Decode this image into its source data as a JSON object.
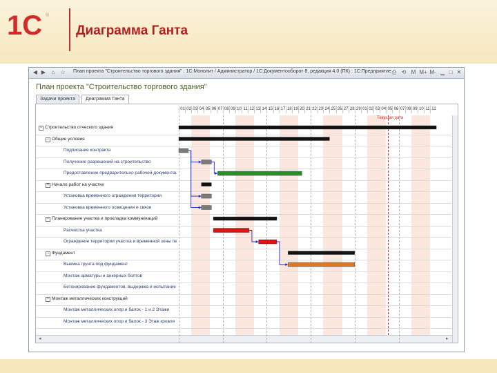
{
  "slide": {
    "title": "Диаграмма Ганта",
    "logo_text": "1С",
    "accent_color": "#c62828",
    "header_bg": "#f6e7bd"
  },
  "window": {
    "title": "План проекта \"Строительство торгового здания\" : 1С:Монолит / Администратор / 1С:Документооборот 8, редакция 4.0 (ПК) : 1С:Предприятие",
    "toolbar_icons": [
      "back-icon",
      "forward-icon",
      "home-icon",
      "favorite-icon"
    ],
    "window_icons": [
      "print-icon",
      "history-icon",
      "M",
      "M+",
      "M-",
      "minimize-icon",
      "maximize-icon",
      "close-icon"
    ]
  },
  "form": {
    "title": "План проекта \"Строительство торгового здания\"",
    "tabs": [
      {
        "label": "Задачи проекта",
        "active": false
      },
      {
        "label": "Диаграмма Ганта",
        "active": true
      }
    ]
  },
  "gantt": {
    "today_label": "Текущая дата",
    "columns": [
      "01",
      "02",
      "03",
      "04",
      "05",
      "06",
      "07",
      "08",
      "09",
      "10",
      "11",
      "12",
      "13",
      "14",
      "15",
      "16",
      "17",
      "18",
      "19",
      "20",
      "21",
      "22",
      "23",
      "24",
      "25",
      "26",
      "27",
      "28",
      "29",
      "01",
      "02",
      "03",
      "04",
      "05",
      "06",
      "07",
      "08",
      "09",
      "10",
      "11",
      "12"
    ],
    "weekend_columns": [
      2,
      3,
      9,
      10,
      16,
      17,
      23,
      24,
      30,
      31,
      37,
      38
    ],
    "today_column": 33.3,
    "colors": {
      "summary": "#111111",
      "normal": "#7a7a7a",
      "green": "#2e8b2e",
      "red": "#e31010",
      "orange": "#d97a2b",
      "link": "#1f2fc7"
    },
    "tasks": [
      {
        "label": "Строительство отческого здания",
        "level": 0,
        "expander": "−",
        "start": 0,
        "end": 41,
        "kind": "summary"
      },
      {
        "label": "Общие условия",
        "level": 1,
        "expander": "−",
        "start": 0,
        "end": 24,
        "kind": "summary"
      },
      {
        "label": "Подписание контракта",
        "level": 2,
        "expander": "",
        "start": 0,
        "end": 1.5,
        "kind": "normal"
      },
      {
        "label": "Получение разрешений на строительство",
        "level": 2,
        "expander": "",
        "start": 3.6,
        "end": 5.2,
        "kind": "normal"
      },
      {
        "label": "Предоставление предварительно рабочей документации",
        "level": 2,
        "expander": "",
        "start": 6.2,
        "end": 19.6,
        "kind": "green"
      },
      {
        "label": "Начало работ на участке",
        "level": 1,
        "expander": "+",
        "start": 3.6,
        "end": 5.2,
        "kind": "summary"
      },
      {
        "label": "Установка временного ограждения территории",
        "level": 2,
        "expander": "",
        "start": 3.6,
        "end": 5.2,
        "kind": "normal"
      },
      {
        "label": "Установка временного освещения и связи",
        "level": 2,
        "expander": "",
        "start": 3.6,
        "end": 5.2,
        "kind": "normal"
      },
      {
        "label": "Планирование участка и прокладка коммуникаций",
        "level": 1,
        "expander": "−",
        "start": 5.5,
        "end": 15.6,
        "kind": "summary"
      },
      {
        "label": "Расчистка участка",
        "level": 2,
        "expander": "",
        "start": 5.5,
        "end": 11.2,
        "kind": "red"
      },
      {
        "label": "Ограждение территории участка и временной зоны персонала",
        "level": 2,
        "expander": "",
        "start": 12.7,
        "end": 15.6,
        "kind": "red"
      },
      {
        "label": "Фундамент",
        "level": 1,
        "expander": "−",
        "start": 17.4,
        "end": 28,
        "kind": "summary"
      },
      {
        "label": "Выемка грунта под фундамент",
        "level": 2,
        "expander": "",
        "start": 17.4,
        "end": 28,
        "kind": "orange"
      },
      {
        "label": "Монтаж арматуры и анкерных болтов",
        "level": 2,
        "expander": "",
        "start": null,
        "end": null,
        "kind": "none"
      },
      {
        "label": "Бетонирование фундаментов, выдержка и испытание фундаментов",
        "level": 2,
        "expander": "",
        "start": null,
        "end": null,
        "kind": "none"
      },
      {
        "label": "Монтаж металлических конструкций",
        "level": 1,
        "expander": "−",
        "start": null,
        "end": null,
        "kind": "none"
      },
      {
        "label": "Монтаж металлических опор и балок - 1 и 2 Этажи",
        "level": 2,
        "expander": "",
        "start": null,
        "end": null,
        "kind": "none"
      },
      {
        "label": "Монтаж металлических опор и балок - 3 Этаж кровля",
        "level": 2,
        "expander": "",
        "start": null,
        "end": null,
        "kind": "none"
      }
    ]
  }
}
